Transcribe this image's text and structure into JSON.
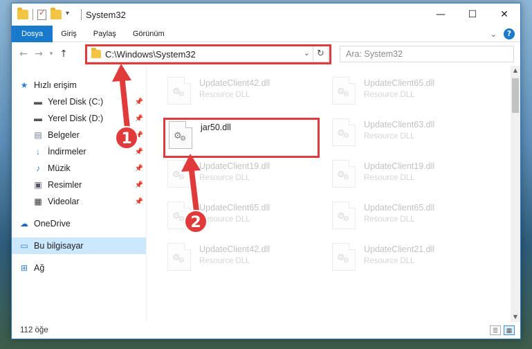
{
  "window": {
    "title": "System32",
    "controls": {
      "minimize": "—",
      "maximize": "☐",
      "close": "✕"
    }
  },
  "ribbon": {
    "tabs": [
      "Dosya",
      "Giriş",
      "Paylaş",
      "Görünüm"
    ]
  },
  "address": {
    "path": "C:\\Windows\\System32"
  },
  "search": {
    "placeholder": "Ara: System32"
  },
  "sidebar": {
    "items": [
      {
        "label": "Hızlı erişim",
        "icon": "star-icon"
      },
      {
        "label": "Yerel Disk (C:)",
        "icon": "drive-icon",
        "pinned": true
      },
      {
        "label": "Yerel Disk (D:)",
        "icon": "drive-icon",
        "pinned": true
      },
      {
        "label": "Belgeler",
        "icon": "documents-icon",
        "pinned": true
      },
      {
        "label": "İndirmeler",
        "icon": "download-icon",
        "pinned": true
      },
      {
        "label": "Müzik",
        "icon": "music-icon",
        "pinned": true
      },
      {
        "label": "Resimler",
        "icon": "pictures-icon",
        "pinned": true
      },
      {
        "label": "Videolar",
        "icon": "videos-icon",
        "pinned": true
      },
      {
        "label": "OneDrive",
        "icon": "cloud-icon"
      },
      {
        "label": "Bu bilgisayar",
        "icon": "computer-icon",
        "selected": true
      },
      {
        "label": "Ağ",
        "icon": "network-icon"
      }
    ]
  },
  "files": {
    "highlighted": {
      "name": "jar50.dll",
      "type": ""
    },
    "faded": [
      {
        "name": "UpdateClient42.dll",
        "type": "Resource DLL"
      },
      {
        "name": "UpdateClient65.dll",
        "type": "Resource DLL"
      },
      {
        "name": "UpdateClient63.dll",
        "type": "Resource DLL"
      },
      {
        "name": "UpdateClient19.dll",
        "type": "Resource DLL"
      },
      {
        "name": "UpdateClient19.dll",
        "type": "Resource DLL"
      },
      {
        "name": "UpdateClient65.dll",
        "type": "Resource DLL"
      },
      {
        "name": "UpdateClient65.dll",
        "type": "Resource DLL"
      },
      {
        "name": "UpdateClient42.dll",
        "type": "Resource DLL"
      },
      {
        "name": "UpdateClient21.dll",
        "type": "Resource DLL"
      }
    ]
  },
  "status": {
    "count": "112 öğe"
  },
  "annotations": {
    "step1": "1",
    "step2": "2",
    "color": "#e03a3a"
  }
}
